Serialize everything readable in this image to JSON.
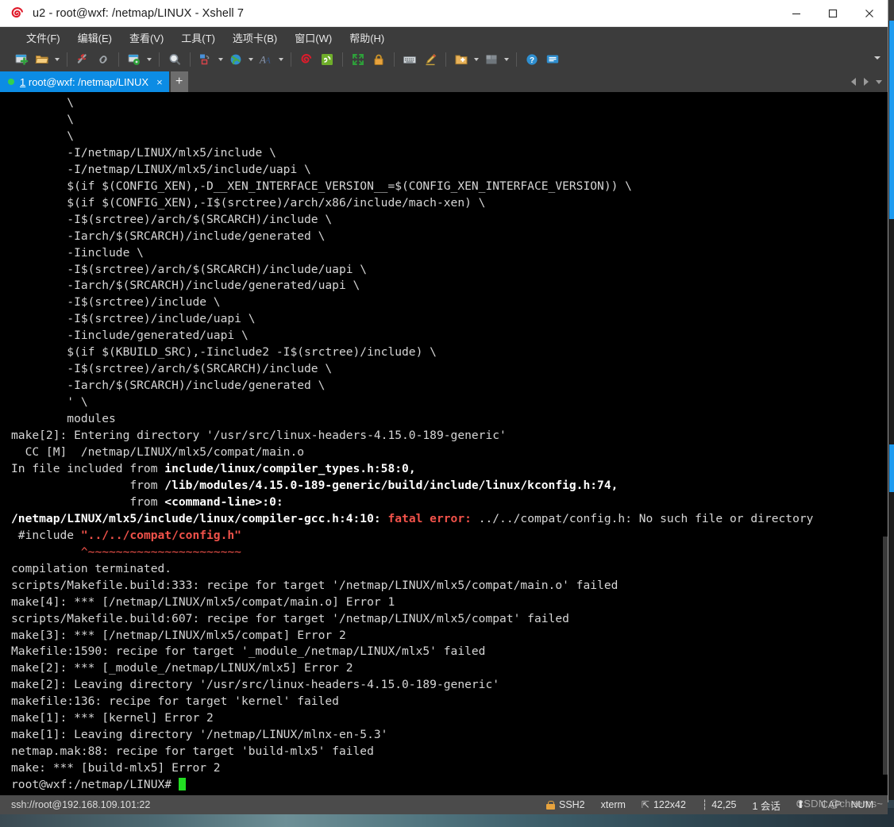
{
  "window": {
    "title": "u2 - root@wxf: /netmap/LINUX - Xshell 7",
    "logo_icon": "xshell-spiral-icon",
    "controls": [
      {
        "name": "minimize-button",
        "icon": "minimize-icon"
      },
      {
        "name": "maximize-button",
        "icon": "maximize-icon"
      },
      {
        "name": "close-button",
        "icon": "close-icon"
      }
    ]
  },
  "menubar": {
    "items": [
      {
        "label": "文件(F)",
        "name": "menu-file"
      },
      {
        "label": "编辑(E)",
        "name": "menu-edit"
      },
      {
        "label": "查看(V)",
        "name": "menu-view"
      },
      {
        "label": "工具(T)",
        "name": "menu-tools"
      },
      {
        "label": "选项卡(B)",
        "name": "menu-tabs"
      },
      {
        "label": "窗口(W)",
        "name": "menu-window"
      },
      {
        "label": "帮助(H)",
        "name": "menu-help"
      }
    ]
  },
  "toolbar": {
    "icons": [
      "new-session-icon",
      "open-folder-icon",
      "disconnect-icon",
      "reconnect-icon",
      "session-properties-icon",
      "find-icon",
      "layout-icon",
      "globe-encoding-icon",
      "font-icon",
      "xshell-icon",
      "xftp-icon",
      "fullscreen-icon",
      "lock-icon",
      "keyboard-icon",
      "highlight-pen-icon",
      "add-folder-icon",
      "arrange-icon",
      "help-icon",
      "chat-icon"
    ],
    "overflow_icon": "chevron-down-icon"
  },
  "tabs": {
    "active": {
      "index": "1",
      "label": "root@wxf: /netmap/LINUX",
      "status_icon": "green-dot-icon",
      "close_icon": "close-icon"
    },
    "new_tab_label": "+",
    "nav": [
      "prev-tab-arrow",
      "next-tab-arrow",
      "tab-list-chevron"
    ]
  },
  "terminal": {
    "cols_rows": "122x42",
    "lines": [
      {
        "segs": [
          {
            "t": "        \\"
          }
        ]
      },
      {
        "segs": [
          {
            "t": "        \\"
          }
        ]
      },
      {
        "segs": [
          {
            "t": "        \\"
          }
        ]
      },
      {
        "segs": [
          {
            "t": "        -I/netmap/LINUX/mlx5/include \\"
          }
        ]
      },
      {
        "segs": [
          {
            "t": "        -I/netmap/LINUX/mlx5/include/uapi \\"
          }
        ]
      },
      {
        "segs": [
          {
            "t": "        $(if $(CONFIG_XEN),-D__XEN_INTERFACE_VERSION__=$(CONFIG_XEN_INTERFACE_VERSION)) \\"
          }
        ]
      },
      {
        "segs": [
          {
            "t": "        $(if $(CONFIG_XEN),-I$(srctree)/arch/x86/include/mach-xen) \\"
          }
        ]
      },
      {
        "segs": [
          {
            "t": "        -I$(srctree)/arch/$(SRCARCH)/include \\"
          }
        ]
      },
      {
        "segs": [
          {
            "t": "        -Iarch/$(SRCARCH)/include/generated \\"
          }
        ]
      },
      {
        "segs": [
          {
            "t": "        -Iinclude \\"
          }
        ]
      },
      {
        "segs": [
          {
            "t": "        -I$(srctree)/arch/$(SRCARCH)/include/uapi \\"
          }
        ]
      },
      {
        "segs": [
          {
            "t": "        -Iarch/$(SRCARCH)/include/generated/uapi \\"
          }
        ]
      },
      {
        "segs": [
          {
            "t": "        -I$(srctree)/include \\"
          }
        ]
      },
      {
        "segs": [
          {
            "t": "        -I$(srctree)/include/uapi \\"
          }
        ]
      },
      {
        "segs": [
          {
            "t": "        -Iinclude/generated/uapi \\"
          }
        ]
      },
      {
        "segs": [
          {
            "t": "        $(if $(KBUILD_SRC),-Iinclude2 -I$(srctree)/include) \\"
          }
        ]
      },
      {
        "segs": [
          {
            "t": "        -I$(srctree)/arch/$(SRCARCH)/include \\"
          }
        ]
      },
      {
        "segs": [
          {
            "t": "        -Iarch/$(SRCARCH)/include/generated \\"
          }
        ]
      },
      {
        "segs": [
          {
            "t": "        ' \\"
          }
        ]
      },
      {
        "segs": [
          {
            "t": "        modules"
          }
        ]
      },
      {
        "segs": [
          {
            "t": "make[2]: Entering directory '/usr/src/linux-headers-4.15.0-189-generic'"
          }
        ]
      },
      {
        "segs": [
          {
            "t": "  CC [M]  /netmap/LINUX/mlx5/compat/main.o"
          }
        ]
      },
      {
        "segs": [
          {
            "t": "In file included from "
          },
          {
            "t": "include/linux/compiler_types.h:58:0,",
            "c": "b"
          }
        ]
      },
      {
        "segs": [
          {
            "t": "                 from "
          },
          {
            "t": "/lib/modules/4.15.0-189-generic/build/include/linux/kconfig.h:74,",
            "c": "b"
          }
        ]
      },
      {
        "segs": [
          {
            "t": "                 from "
          },
          {
            "t": "<command-line>:0:",
            "c": "b"
          }
        ]
      },
      {
        "segs": [
          {
            "t": "/netmap/LINUX/mlx5/include/linux/compiler-gcc.h:4:10: ",
            "c": "b"
          },
          {
            "t": "fatal error:",
            "c": "red"
          },
          {
            "t": " ../../compat/config.h: No such file or directory"
          }
        ]
      },
      {
        "segs": [
          {
            "t": " #include "
          },
          {
            "t": "\"../../compat/config.h\"",
            "c": "red"
          }
        ]
      },
      {
        "segs": [
          {
            "t": "          "
          },
          {
            "t": "^~~~~~~~~~~~~~~~~~~~~~~",
            "c": "squig"
          }
        ]
      },
      {
        "segs": [
          {
            "t": "compilation terminated."
          }
        ]
      },
      {
        "segs": [
          {
            "t": "scripts/Makefile.build:333: recipe for target '/netmap/LINUX/mlx5/compat/main.o' failed"
          }
        ]
      },
      {
        "segs": [
          {
            "t": "make[4]: *** [/netmap/LINUX/mlx5/compat/main.o] Error 1"
          }
        ]
      },
      {
        "segs": [
          {
            "t": "scripts/Makefile.build:607: recipe for target '/netmap/LINUX/mlx5/compat' failed"
          }
        ]
      },
      {
        "segs": [
          {
            "t": "make[3]: *** [/netmap/LINUX/mlx5/compat] Error 2"
          }
        ]
      },
      {
        "segs": [
          {
            "t": "Makefile:1590: recipe for target '_module_/netmap/LINUX/mlx5' failed"
          }
        ]
      },
      {
        "segs": [
          {
            "t": "make[2]: *** [_module_/netmap/LINUX/mlx5] Error 2"
          }
        ]
      },
      {
        "segs": [
          {
            "t": "make[2]: Leaving directory '/usr/src/linux-headers-4.15.0-189-generic'"
          }
        ]
      },
      {
        "segs": [
          {
            "t": "makefile:136: recipe for target 'kernel' failed"
          }
        ]
      },
      {
        "segs": [
          {
            "t": "make[1]: *** [kernel] Error 2"
          }
        ]
      },
      {
        "segs": [
          {
            "t": "make[1]: Leaving directory '/netmap/LINUX/mlnx-en-5.3'"
          }
        ]
      },
      {
        "segs": [
          {
            "t": "netmap.mak:88: recipe for target 'build-mlx5' failed"
          }
        ]
      },
      {
        "segs": [
          {
            "t": "make: *** [build-mlx5] Error 2"
          }
        ]
      },
      {
        "segs": [
          {
            "t": "root@wxf:/netmap/LINUX# "
          },
          {
            "t": "",
            "c": "cursor"
          }
        ]
      }
    ]
  },
  "statusbar": {
    "connection": "ssh://root@192.168.109.101:22",
    "protocol": "SSH2",
    "lock_icon": "lock-icon",
    "terminal_type": "xterm",
    "size_icon": "resize-icon",
    "size": "122x42",
    "cursor_icon": "cursor-pos-icon",
    "cursor_pos": "42,25",
    "sessions": "1 会话",
    "transfer_icon": "upload-arrow-icon",
    "caps": "CAP",
    "num": "NUM",
    "watermark": "CSDN @cheems~"
  },
  "colors": {
    "accent": "#0c8ce4",
    "chrome": "#3c3c3c",
    "terminal_bg": "#000000",
    "terminal_fg": "#d6d6d6",
    "error_red": "#f1524a",
    "prompt_cursor": "#22dd22",
    "status_bg": "#4b4b4b"
  }
}
